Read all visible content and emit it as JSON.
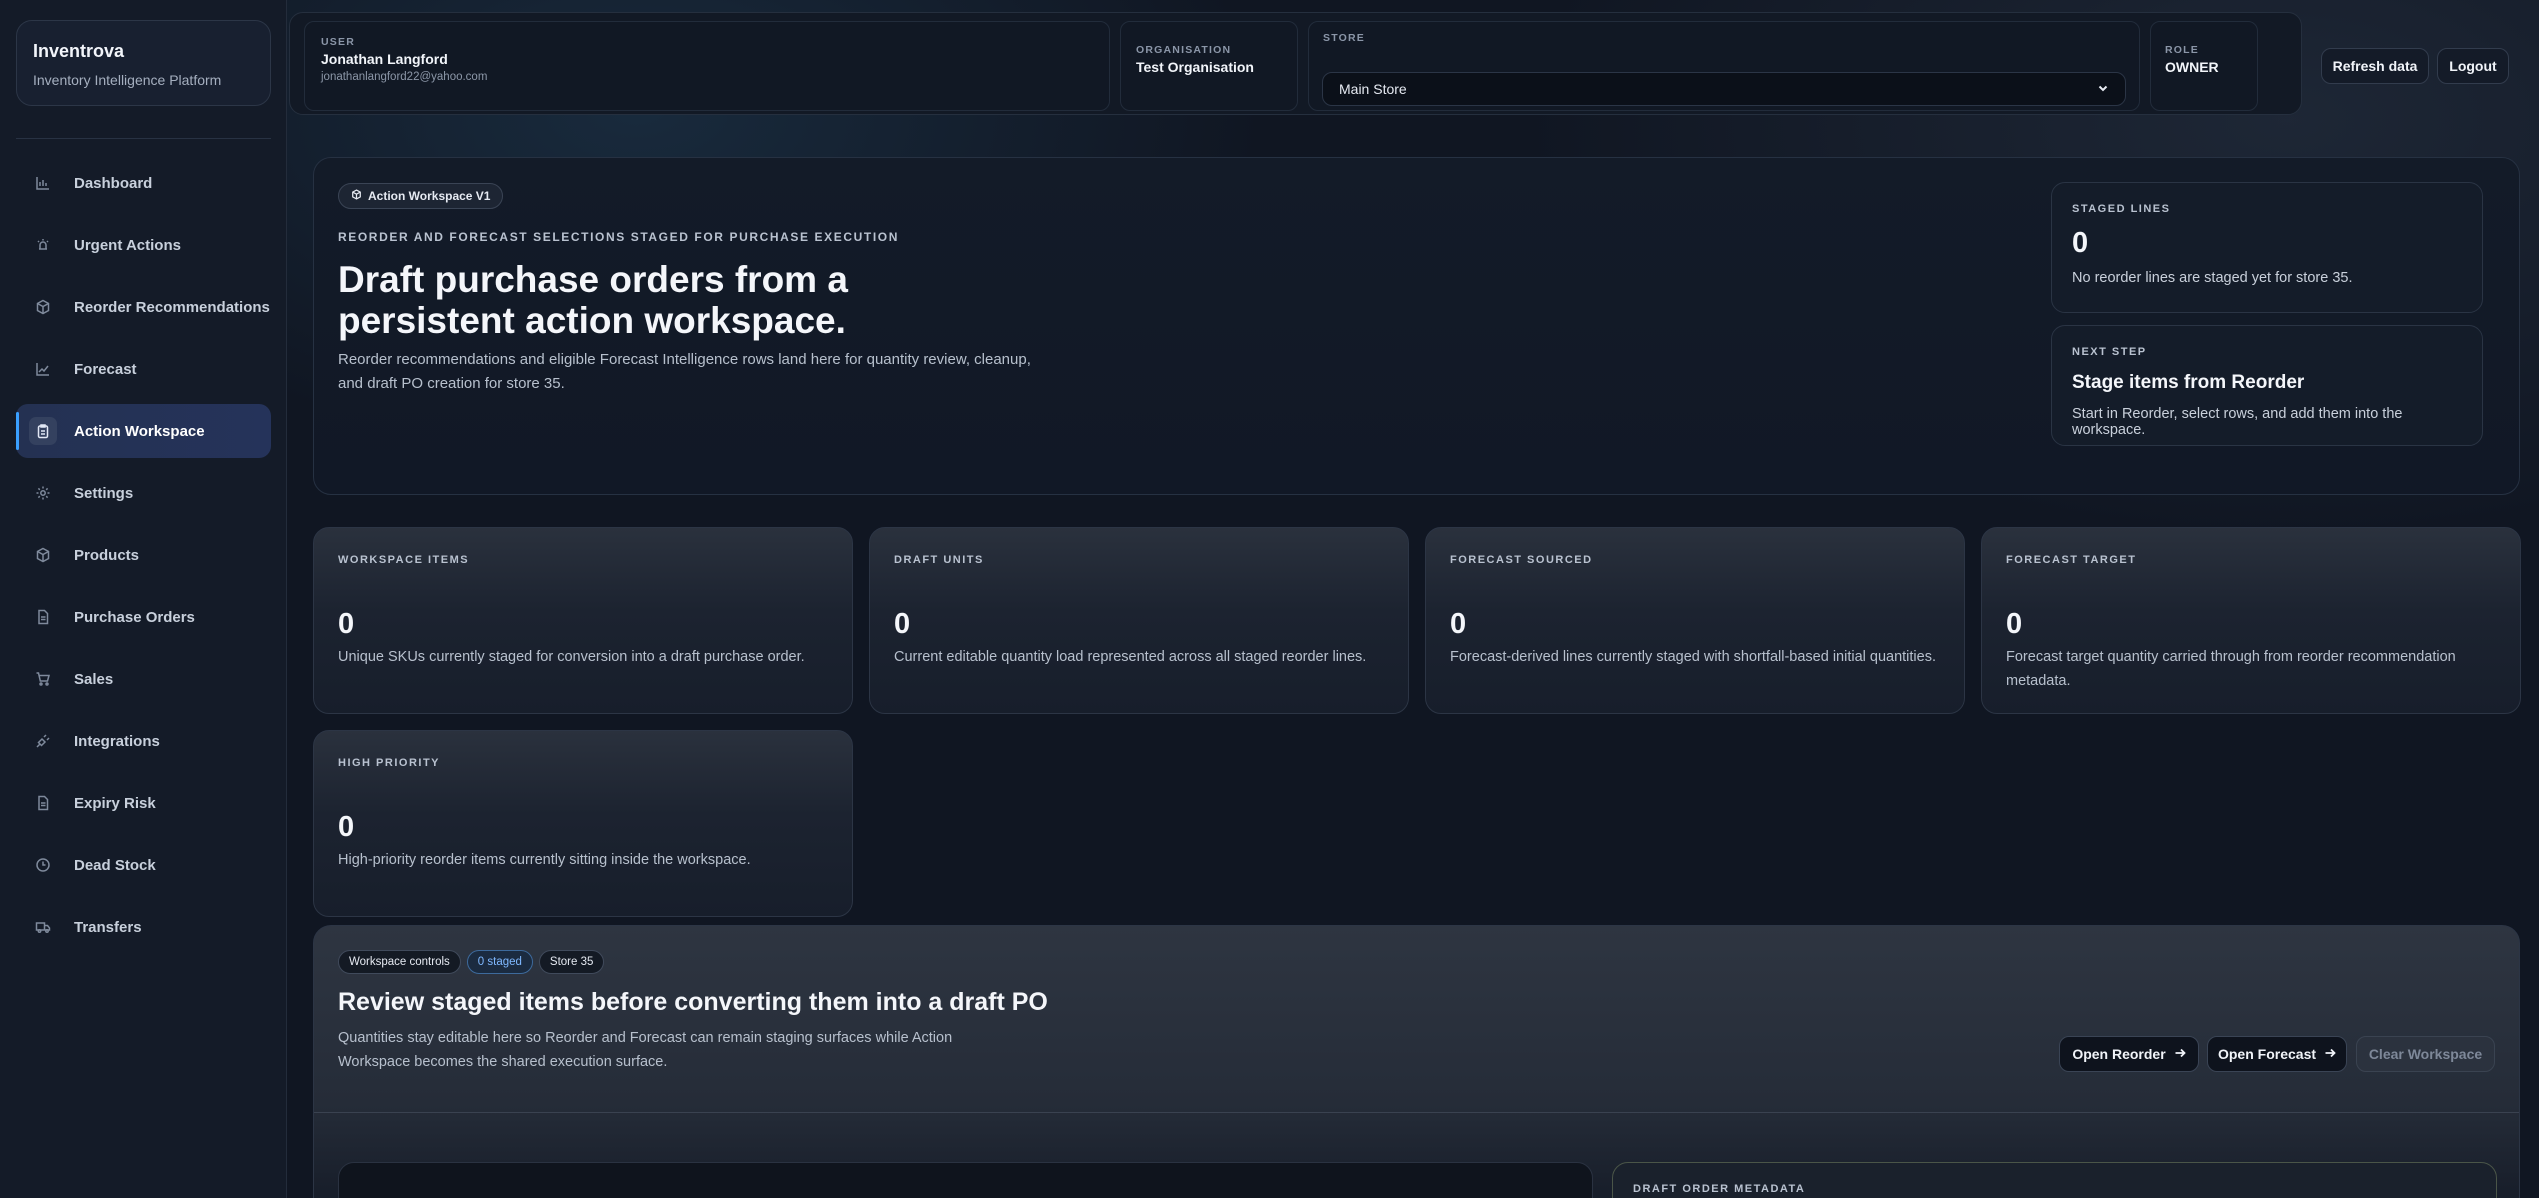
{
  "brand": {
    "name": "Inventrova",
    "tagline": "Inventory Intelligence Platform"
  },
  "nav": [
    {
      "label": "Dashboard",
      "icon": "chart-icon"
    },
    {
      "label": "Urgent Actions",
      "icon": "alert-icon"
    },
    {
      "label": "Reorder Recommendations",
      "icon": "box-icon"
    },
    {
      "label": "Forecast",
      "icon": "trend-icon"
    },
    {
      "label": "Action Workspace",
      "icon": "clipboard-icon",
      "active": true
    },
    {
      "label": "Settings",
      "icon": "gear-icon"
    },
    {
      "label": "Products",
      "icon": "package-icon"
    },
    {
      "label": "Purchase Orders",
      "icon": "document-icon"
    },
    {
      "label": "Sales",
      "icon": "cart-icon"
    },
    {
      "label": "Integrations",
      "icon": "plug-icon"
    },
    {
      "label": "Expiry Risk",
      "icon": "file-icon"
    },
    {
      "label": "Dead Stock",
      "icon": "clock-icon"
    },
    {
      "label": "Transfers",
      "icon": "truck-icon"
    }
  ],
  "topbar": {
    "user_label": "USER",
    "user_name": "Jonathan Langford",
    "user_email": "jonathanlangford22@yahoo.com",
    "org_label": "ORGANISATION",
    "org_name": "Test Organisation",
    "store_label": "STORE",
    "store_value": "Main Store",
    "role_label": "ROLE",
    "role_value": "OWNER",
    "refresh_label": "Refresh data",
    "logout_label": "Logout"
  },
  "hero": {
    "pill": "Action Workspace V1",
    "eyebrow": "REORDER AND FORECAST SELECTIONS STAGED FOR PURCHASE EXECUTION",
    "title": "Draft purchase orders from a persistent action workspace.",
    "description": "Reorder recommendations and eligible Forecast Intelligence rows land here for quantity review, cleanup, and draft PO creation for store 35.",
    "staged_label": "STAGED LINES",
    "staged_value": "0",
    "staged_note": "No reorder lines are staged yet for store 35.",
    "next_label": "NEXT STEP",
    "next_title": "Stage items from Reorder",
    "next_note": "Start in Reorder, select rows, and add them into the workspace."
  },
  "stats": [
    {
      "label": "WORKSPACE ITEMS",
      "value": "0",
      "desc": "Unique SKUs currently staged for conversion into a draft purchase order."
    },
    {
      "label": "DRAFT UNITS",
      "value": "0",
      "desc": "Current editable quantity load represented across all staged reorder lines."
    },
    {
      "label": "FORECAST SOURCED",
      "value": "0",
      "desc": "Forecast-derived lines currently staged with shortfall-based initial quantities."
    },
    {
      "label": "FORECAST TARGET",
      "value": "0",
      "desc": "Forecast target quantity carried through from reorder recommendation metadata."
    },
    {
      "label": "HIGH PRIORITY",
      "value": "0",
      "desc": "High-priority reorder items currently sitting inside the workspace."
    }
  ],
  "controls": {
    "tags": [
      "Workspace controls",
      "0 staged",
      "Store 35"
    ],
    "title": "Review staged items before converting them into a draft PO",
    "description": "Quantities stay editable here so Reorder and Forecast can remain staging surfaces while Action Workspace becomes the shared execution surface.",
    "open_reorder": "Open Reorder",
    "open_forecast": "Open Forecast",
    "clear_workspace": "Clear Workspace",
    "metadata_label": "DRAFT ORDER METADATA"
  },
  "colors": {
    "accent": "#3aa0ff",
    "background": "#101622",
    "tag_blue": "#7fb8ff"
  }
}
